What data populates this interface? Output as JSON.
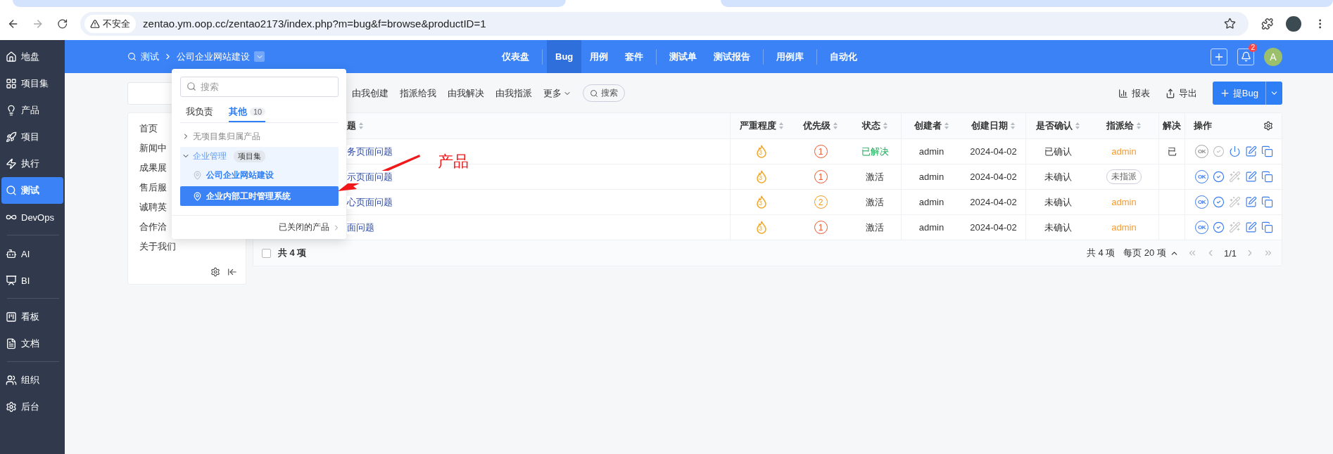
{
  "browser": {
    "security": "不安全",
    "url": "zentao.ym.oop.cc/zentao2173/index.php?m=bug&f=browse&productID=1"
  },
  "sidebar": {
    "groups": [
      {
        "items": [
          {
            "label": "地盘",
            "selected": false
          },
          {
            "label": "项目集",
            "selected": false
          },
          {
            "label": "产品",
            "selected": false
          },
          {
            "label": "项目",
            "selected": false
          },
          {
            "label": "执行",
            "selected": false
          },
          {
            "label": "测试",
            "selected": true
          },
          {
            "label": "DevOps",
            "selected": false
          }
        ]
      },
      {
        "items": [
          {
            "label": "AI",
            "selected": false
          },
          {
            "label": "BI",
            "selected": false
          }
        ]
      },
      {
        "items": [
          {
            "label": "看板",
            "selected": false
          },
          {
            "label": "文档",
            "selected": false
          }
        ]
      },
      {
        "items": [
          {
            "label": "组织",
            "selected": false
          },
          {
            "label": "后台",
            "selected": false
          }
        ]
      }
    ]
  },
  "header": {
    "breadcrumb": [
      "测试",
      "公司企业网站建设"
    ],
    "nav_groups": [
      {
        "items": [
          {
            "label": "仪表盘",
            "selected": false
          }
        ]
      },
      {
        "items": [
          {
            "label": "Bug",
            "selected": true
          },
          {
            "label": "用例",
            "selected": false
          },
          {
            "label": "套件",
            "selected": false
          }
        ]
      },
      {
        "items": [
          {
            "label": "测试单",
            "selected": false
          },
          {
            "label": "测试报告",
            "selected": false
          }
        ]
      },
      {
        "items": [
          {
            "label": "用例库",
            "selected": false
          }
        ]
      },
      {
        "items": [
          {
            "label": "自动化",
            "selected": false
          }
        ]
      }
    ],
    "notifications": "2",
    "avatar": "A"
  },
  "toolbar": {
    "tabs": [
      "由我创建",
      "指派给我",
      "由我解决",
      "由我指派"
    ],
    "more": "更多",
    "search": "搜索",
    "report": "报表",
    "export": "导出",
    "create": "提Bug"
  },
  "module_tree": {
    "items": [
      "首页",
      "新闻中",
      "成果展",
      "售后服",
      "诚聘英",
      "合作洽",
      "关于我们"
    ]
  },
  "table": {
    "columns": [
      "题",
      "严重程度",
      "优先级",
      "状态",
      "创建者",
      "创建日期",
      "是否确认",
      "指派给",
      "解决",
      "操作"
    ],
    "rows": [
      {
        "title": "务页面问题",
        "severity": "3",
        "priority": {
          "text": "1",
          "color": "#f0562b"
        },
        "status": {
          "text": "已解决",
          "kind": "resolved"
        },
        "creator": "admin",
        "created": "2024-04-02",
        "confirmed": "已确认",
        "assignee": {
          "text": "admin",
          "kind": "user"
        },
        "resolution": "已",
        "actions": [
          {
            "kind": "ok",
            "label": "OK",
            "disabled": true
          },
          {
            "kind": "check",
            "disabled": true
          },
          {
            "kind": "power",
            "disabled": false
          },
          {
            "kind": "edit",
            "disabled": false
          },
          {
            "kind": "copy",
            "disabled": false
          }
        ]
      },
      {
        "title": "示页面问题",
        "severity": "3",
        "priority": {
          "text": "1",
          "color": "#f0562b"
        },
        "status": {
          "text": "激活",
          "kind": "active"
        },
        "creator": "admin",
        "created": "2024-04-02",
        "confirmed": "未确认",
        "assignee": {
          "text": "未指派",
          "kind": "unassigned"
        },
        "actions": [
          {
            "kind": "ok",
            "label": "OK",
            "disabled": false
          },
          {
            "kind": "check",
            "disabled": false
          },
          {
            "kind": "wand",
            "disabled": true
          },
          {
            "kind": "edit",
            "disabled": false
          },
          {
            "kind": "copy",
            "disabled": false
          }
        ]
      },
      {
        "title": "心页面问题",
        "severity": "3",
        "priority": {
          "text": "2",
          "color": "#f59c1a"
        },
        "status": {
          "text": "激活",
          "kind": "active"
        },
        "creator": "admin",
        "created": "2024-04-02",
        "confirmed": "未确认",
        "assignee": {
          "text": "admin",
          "kind": "user"
        },
        "actions": [
          {
            "kind": "ok",
            "label": "OK",
            "disabled": false
          },
          {
            "kind": "check",
            "disabled": false
          },
          {
            "kind": "wand",
            "disabled": true
          },
          {
            "kind": "edit",
            "disabled": false
          },
          {
            "kind": "copy",
            "disabled": false
          }
        ]
      },
      {
        "title": "面问题",
        "severity": "3",
        "priority": {
          "text": "1",
          "color": "#f0562b"
        },
        "status": {
          "text": "激活",
          "kind": "active"
        },
        "creator": "admin",
        "created": "2024-04-02",
        "confirmed": "未确认",
        "assignee": {
          "text": "admin",
          "kind": "user"
        },
        "actions": [
          {
            "kind": "ok",
            "label": "OK",
            "disabled": false
          },
          {
            "kind": "check",
            "disabled": false
          },
          {
            "kind": "wand",
            "disabled": true
          },
          {
            "kind": "edit",
            "disabled": false
          },
          {
            "kind": "copy",
            "disabled": false
          }
        ]
      }
    ],
    "footer": {
      "select_all_checked": false,
      "selected_count": "共 4 项",
      "total": "共 4 项",
      "page_size": "每页 20 项",
      "page": "1/1"
    }
  },
  "product_menu": {
    "search_placeholder": "搜索",
    "tabs": [
      {
        "label": "我负责",
        "selected": false
      },
      {
        "label": "其他",
        "count": "10",
        "selected": true
      }
    ],
    "tree": [
      {
        "label": "无项目集归属产品",
        "expanded": false
      },
      {
        "label": "企业管理",
        "tag": "项目集",
        "expanded": true,
        "children": [
          {
            "label": "公司企业网站建设",
            "current": true,
            "selected": false
          },
          {
            "label": "企业内部工时管理系统",
            "current": false,
            "selected": true
          }
        ]
      }
    ],
    "closed": "已关闭的产品"
  },
  "annotation": {
    "label": "产品"
  }
}
